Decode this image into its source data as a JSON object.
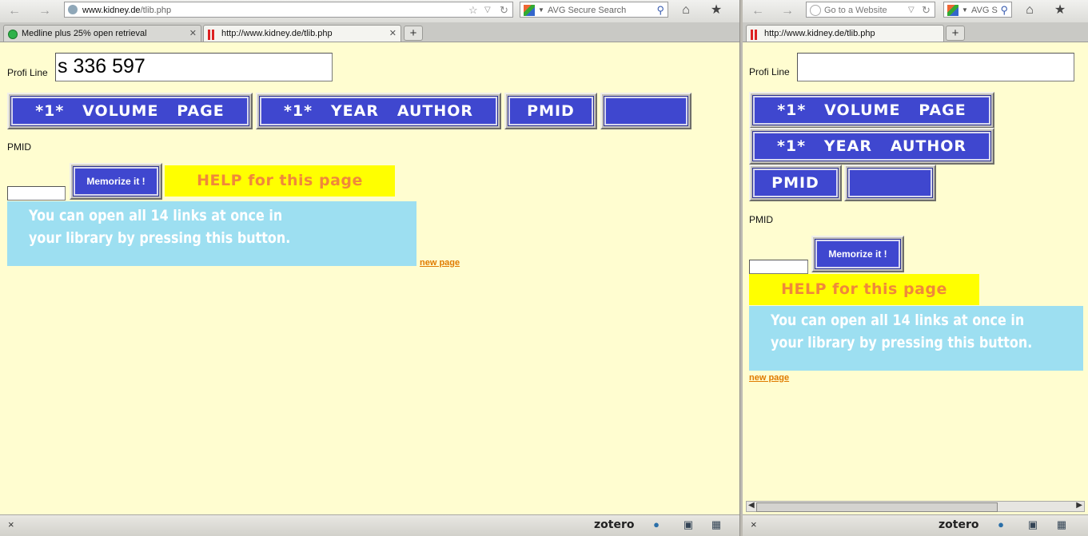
{
  "left_window": {
    "url": "www.kidney.de/tlib.php",
    "url_domain": "www.kidney.de",
    "url_path": "/tlib.php",
    "search_placeholder": "AVG Secure Search",
    "tabs": [
      {
        "label": "Medline plus 25% open retrieval",
        "active": false
      },
      {
        "label": "http://www.kidney.de/tlib.php",
        "active": true
      }
    ],
    "profi_line_label": "Profi Line",
    "profi_line_value": "s 336 597",
    "buttons": {
      "volume_page": "*1*   VOLUME   PAGE",
      "year_author": "*1*   YEAR   AUTHOR",
      "pmid": "PMID",
      "blank": ""
    },
    "pmid_label": "PMID",
    "pmid_value": "",
    "memorize_label": "Memorize it !",
    "help_label": "HELP for this page",
    "info_line1": "You can open all 14 links at once in",
    "info_line2": "your library by pressing this button.",
    "new_page_link": "new page",
    "status_close": "×",
    "zotero": "zotero"
  },
  "right_window": {
    "url_placeholder": "Go to a Website",
    "search_placeholder": "AVG S",
    "tabs": [
      {
        "label": "http://www.kidney.de/tlib.php",
        "active": true
      }
    ],
    "profi_line_label": "Profi Line",
    "profi_line_value": "",
    "buttons": {
      "volume_page": "*1*   VOLUME   PAGE",
      "year_author": "*1*   YEAR   AUTHOR",
      "pmid": "PMID",
      "blank": ""
    },
    "pmid_label": "PMID",
    "pmid_value": "",
    "memorize_label": "Memorize it !",
    "help_label": "HELP for this page",
    "info_line1": "You can open all 14 links at once in",
    "info_line2": "your library by pressing this button.",
    "new_page_link": "new page",
    "status_close": "×",
    "zotero": "zotero"
  },
  "icons": {
    "back": "back-arrow-icon",
    "forward": "forward-arrow-icon",
    "home": "home-icon",
    "bookmarks": "bookmarks-icon",
    "reload": "reload-icon",
    "search": "search-icon",
    "globe": "globe-icon",
    "star": "bookmark-star-icon"
  },
  "colors": {
    "page_bg": "#fffdd0",
    "button_blue": "#3f47cf",
    "help_bg": "#ffff00",
    "help_text": "#f0883a",
    "info_bg": "#9ddff1",
    "link": "#e07b00"
  }
}
